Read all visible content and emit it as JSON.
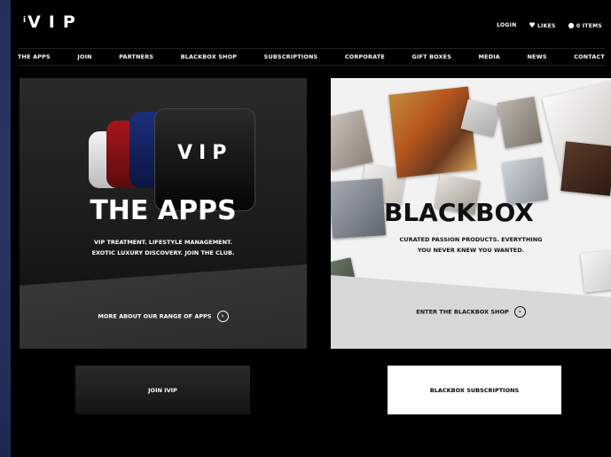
{
  "header": {
    "logo_text": "VIP",
    "logo_prefix": "i",
    "account": {
      "login": "LOGIN",
      "likes": "LIKES",
      "basket": "0 ITEMS"
    }
  },
  "nav": {
    "items": [
      "THE APPS",
      "JOIN",
      "PARTNERS",
      "BLACKBOX SHOP",
      "SUBSCRIPTIONS",
      "CORPORATE",
      "GIFT BOXES",
      "MEDIA",
      "NEWS",
      "CONTACT"
    ]
  },
  "apps_panel": {
    "card_text": "VIP",
    "title": "THE APPS",
    "subtitle_line1": "VIP TREATMENT. LIFESTYLE MANAGEMENT.",
    "subtitle_line2": "EXOTIC LUXURY DISCOVERY. JOIN THE CLUB.",
    "link": "MORE ABOUT OUR RANGE OF APPS",
    "link_icon": "›"
  },
  "blackbox_panel": {
    "title": "BLACKBOX",
    "subtitle_line1": "CURATED PASSION PRODUCTS. EVERYTHING",
    "subtitle_line2": "YOU NEVER KNEW YOU WANTED.",
    "link": "ENTER THE BLACKBOX SHOP",
    "link_icon": "›"
  },
  "buttons": {
    "join": "JOIN IVIP",
    "subscriptions": "BLACKBOX SUBSCRIPTIONS"
  },
  "icons": {
    "likes": "heart-icon",
    "basket": "bag-icon",
    "arrow": "arrow-right-circle-icon"
  }
}
